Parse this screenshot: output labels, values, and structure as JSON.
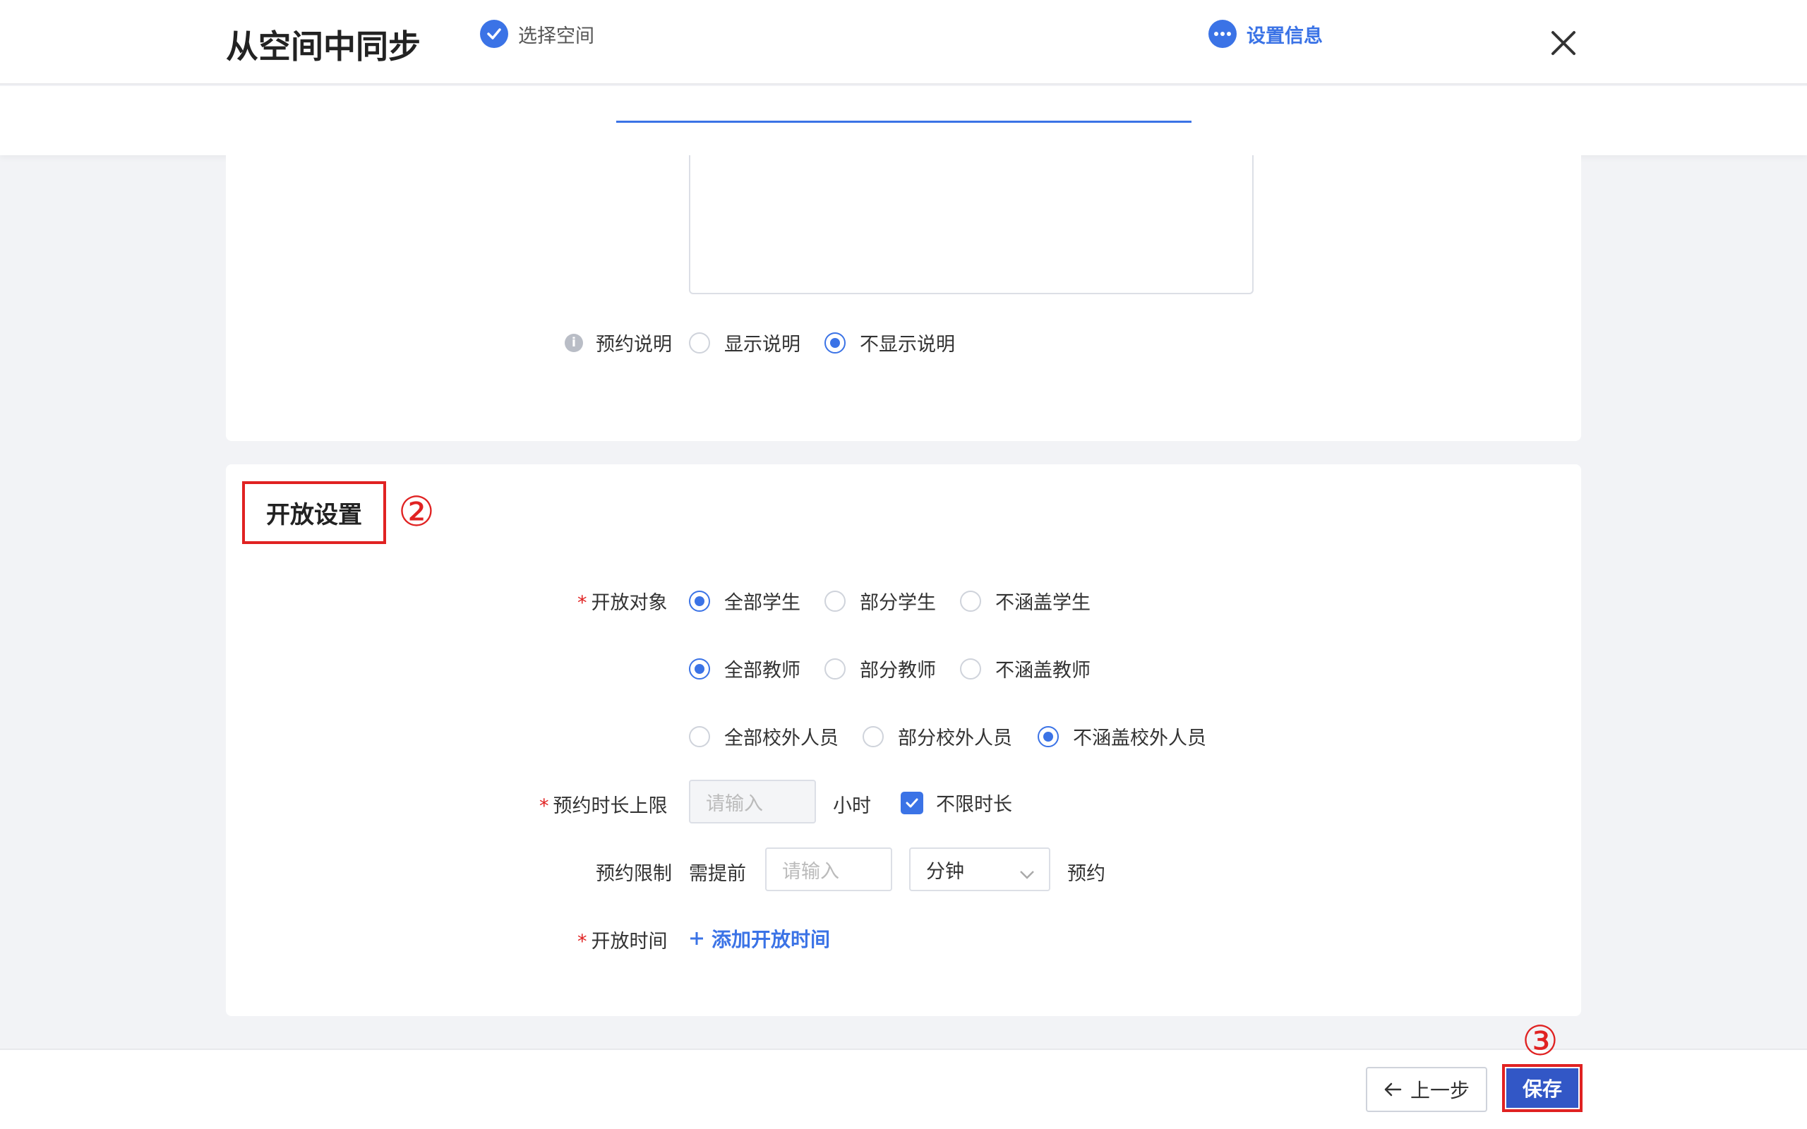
{
  "dialog": {
    "title": "从空间中同步"
  },
  "steps": [
    {
      "label": "选择空间",
      "state": "done"
    },
    {
      "label": "设置信息",
      "state": "active"
    }
  ],
  "booking_note": {
    "label": "预约说明",
    "options": [
      {
        "label": "显示说明",
        "selected": false
      },
      {
        "label": "不显示说明",
        "selected": true
      }
    ]
  },
  "open_settings": {
    "title": "开放设置",
    "annotation_2": "②",
    "audience": {
      "label": "开放对象",
      "required": "*",
      "students": [
        {
          "label": "全部学生",
          "selected": true
        },
        {
          "label": "部分学生",
          "selected": false
        },
        {
          "label": "不涵盖学生",
          "selected": false
        }
      ],
      "teachers": [
        {
          "label": "全部教师",
          "selected": true
        },
        {
          "label": "部分教师",
          "selected": false
        },
        {
          "label": "不涵盖教师",
          "selected": false
        }
      ],
      "external": [
        {
          "label": "全部校外人员",
          "selected": false
        },
        {
          "label": "部分校外人员",
          "selected": false
        },
        {
          "label": "不涵盖校外人员",
          "selected": true
        }
      ]
    },
    "duration_limit": {
      "label": "预约时长上限",
      "required": "*",
      "placeholder": "请输入",
      "unit": "小时",
      "unlimited_label": "不限时长",
      "unlimited_checked": true
    },
    "booking_limit": {
      "label": "预约限制",
      "prefix": "需提前",
      "placeholder": "请输入",
      "unit_selected": "分钟",
      "suffix": "预约"
    },
    "open_time": {
      "label": "开放时间",
      "required": "*",
      "add_label": "添加开放时间"
    }
  },
  "footer": {
    "prev_label": "上一步",
    "save_label": "保存",
    "annotation_3": "③"
  },
  "colors": {
    "accent": "#3b73e6",
    "annotation": "#e02222",
    "save": "#3257c6"
  }
}
